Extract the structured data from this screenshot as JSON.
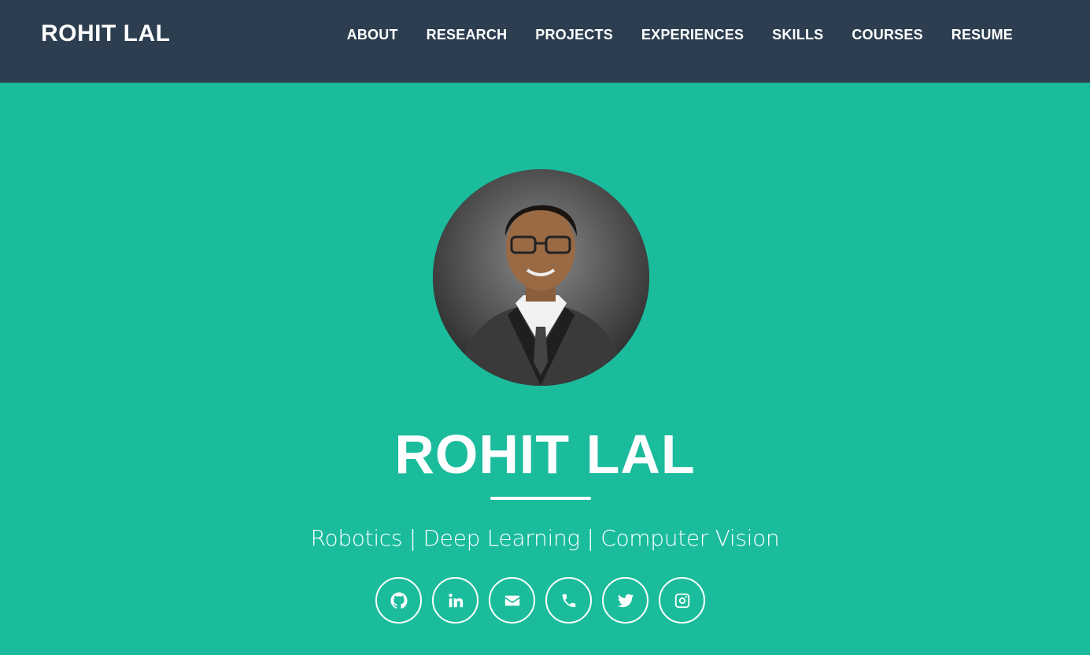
{
  "nav": {
    "brand": "ROHIT LAL",
    "links": [
      {
        "label": "ABOUT"
      },
      {
        "label": "RESEARCH"
      },
      {
        "label": "PROJECTS"
      },
      {
        "label": "EXPERIENCES"
      },
      {
        "label": "SKILLS"
      },
      {
        "label": "COURSES"
      },
      {
        "label": "RESUME"
      }
    ]
  },
  "hero": {
    "name": "ROHIT LAL",
    "tagline": "Robotics | Deep Learning | Computer Vision",
    "avatar_alt": "profile photo"
  },
  "socials": [
    {
      "icon": "github-icon"
    },
    {
      "icon": "linkedin-icon"
    },
    {
      "icon": "envelope-icon"
    },
    {
      "icon": "phone-icon"
    },
    {
      "icon": "twitter-icon"
    },
    {
      "icon": "instagram-icon"
    }
  ],
  "colors": {
    "navbar": "#2c3e50",
    "accent": "#1abc9c",
    "text": "#ffffff"
  }
}
